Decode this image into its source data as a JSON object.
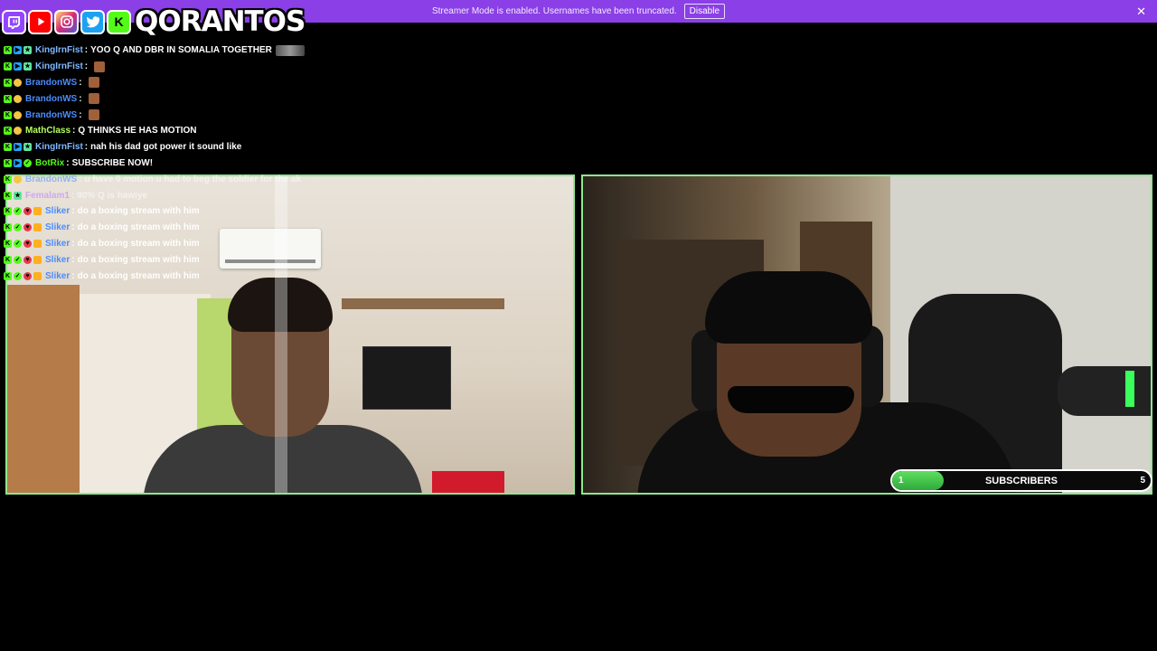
{
  "banner": {
    "text": "Streamer Mode is enabled. Usernames have been truncated.",
    "disable_label": "Disable",
    "close_glyph": "✕",
    "bg_color": "#8b3fe6"
  },
  "logo": {
    "socials": [
      "twitch-icon",
      "youtube-icon",
      "instagram-icon",
      "twitter-icon",
      "kick-icon"
    ],
    "kick_glyph": "K",
    "brand": "QORANTOS"
  },
  "chat": {
    "messages": [
      {
        "user": "KingIrnFist",
        "user_color": "#7fb8ff",
        "text": "YOO Q AND DBR IN SOMALIA TOGETHER",
        "emote": "wide",
        "badges": [
          "kick",
          "prime",
          "sub"
        ],
        "faded": false
      },
      {
        "user": "KingIrnFist",
        "user_color": "#7fb8ff",
        "text": "",
        "emote": "face",
        "badges": [
          "kick",
          "prime",
          "sub"
        ],
        "faded": false
      },
      {
        "user": "BrandonWS",
        "user_color": "#4a8cff",
        "text": "",
        "emote": "face",
        "badges": [
          "kick",
          "moon"
        ],
        "faded": false
      },
      {
        "user": "BrandonWS",
        "user_color": "#4a8cff",
        "text": "",
        "emote": "face",
        "badges": [
          "kick",
          "moon"
        ],
        "faded": false
      },
      {
        "user": "BrandonWS",
        "user_color": "#4a8cff",
        "text": "",
        "emote": "face",
        "badges": [
          "kick",
          "moon"
        ],
        "faded": false
      },
      {
        "user": "MathClass",
        "user_color": "#b6ff5c",
        "text": "Q THINKS HE HAS MOTION",
        "emote": "",
        "badges": [
          "kick",
          "moon"
        ],
        "faded": false
      },
      {
        "user": "KingIrnFist",
        "user_color": "#7fb8ff",
        "text": "nah his dad got power it sound like",
        "emote": "",
        "badges": [
          "kick",
          "prime",
          "sub"
        ],
        "faded": false
      },
      {
        "user": "BotRix",
        "user_color": "#53fc18",
        "text": "SUBSCRIBE NOW!",
        "emote": "",
        "badges": [
          "kick",
          "prime",
          "verify"
        ],
        "faded": false
      },
      {
        "user": "BrandonWS",
        "user_color": "#4a8cff",
        "text": "u have 0 motion u had to beg the soldier for the ak",
        "emote": "",
        "badges": [
          "kick",
          "moon"
        ],
        "faded": true
      },
      {
        "user": "Femalam1",
        "user_color": "#b87aff",
        "text": "90% Q is hawiye",
        "emote": "",
        "badges": [
          "kick",
          "sub"
        ],
        "faded": true
      },
      {
        "user": "Sliker",
        "user_color": "#4a8cff",
        "text": "do a boxing stream with him",
        "emote": "",
        "badges": [
          "kick",
          "verify",
          "heart",
          "og"
        ],
        "faded": false
      },
      {
        "user": "Sliker",
        "user_color": "#4a8cff",
        "text": "do a boxing stream with him",
        "emote": "",
        "badges": [
          "kick",
          "verify",
          "heart",
          "og"
        ],
        "faded": false
      },
      {
        "user": "Sliker",
        "user_color": "#4a8cff",
        "text": "do a boxing stream with him",
        "emote": "",
        "badges": [
          "kick",
          "verify",
          "heart",
          "og"
        ],
        "faded": false
      },
      {
        "user": "Sliker",
        "user_color": "#4a8cff",
        "text": "do a boxing stream with him",
        "emote": "",
        "badges": [
          "kick",
          "verify",
          "heart",
          "og"
        ],
        "faded": false
      },
      {
        "user": "Sliker",
        "user_color": "#4a8cff",
        "text": "do a boxing stream with him",
        "emote": "",
        "badges": [
          "kick",
          "verify",
          "heart",
          "og"
        ],
        "faded": false
      }
    ]
  },
  "subscriber_goal": {
    "label": "SUBSCRIBERS",
    "current": "1",
    "target": "5",
    "progress_fraction": 0.2
  },
  "panels": {
    "left": "webcam-guest",
    "right": "webcam-streamer",
    "border_color": "#8ee88e"
  }
}
